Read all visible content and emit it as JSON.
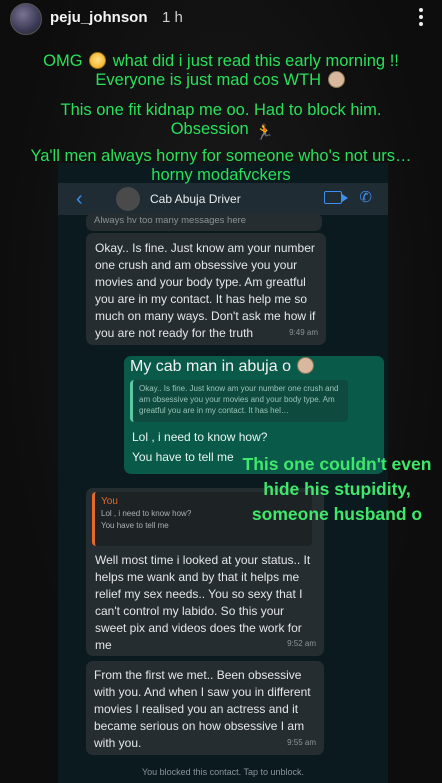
{
  "story": {
    "username": "peju_johnson",
    "time": "1 h",
    "caption_lines": [
      "OMG",
      "what did i just read this early morning !!",
      "Everyone is just mad cos WTH",
      "This one fit kidnap me oo. Had to block him.",
      "Obsession",
      "Ya'll men always horny for someone who's not urs…",
      "horny modafvckers"
    ],
    "overlay_text": "This one couldn't even hide his stupidity, someone husband o"
  },
  "chat": {
    "contact_name": "Cab Abuja Driver",
    "preview_text": "Always hv too many messages here",
    "msg1": {
      "text": "Okay.. Is fine. Just know am your number one crush and am obsessive you your movies and your body type. Am greatful you are in my contact. It has help me so much on many ways. Don't ask me how if you are not ready for the truth",
      "time": "9:49 am"
    },
    "msg2": {
      "heading": "My cab man in abuja o",
      "quote": "Okay.. Is fine. Just know am your number one crush and am obsessive you your movies and your body type. Am greatful you are in my contact. It has hel…",
      "line1": "Lol , i need to know how?",
      "line2": "You have to tell me"
    },
    "msg3": {
      "quote_author": "You",
      "quote_line1": "Lol , i need to know how?",
      "quote_line2": "You have to tell me",
      "text": "Well most time i looked at your status.. It helps me wank and by that it helps me relief my sex needs.. You so sexy that I can't control my labido. So this your sweet pix and videos does the work for me",
      "time": "9:52 am"
    },
    "msg4": {
      "text": "From the first we met.. Been obsessive with you. And when I saw you in different movies I realised you an actress  and it became serious on how obsessive I am with you.",
      "time": "9:55 am"
    },
    "blocked_notice": "You blocked this contact. Tap to unblock."
  }
}
